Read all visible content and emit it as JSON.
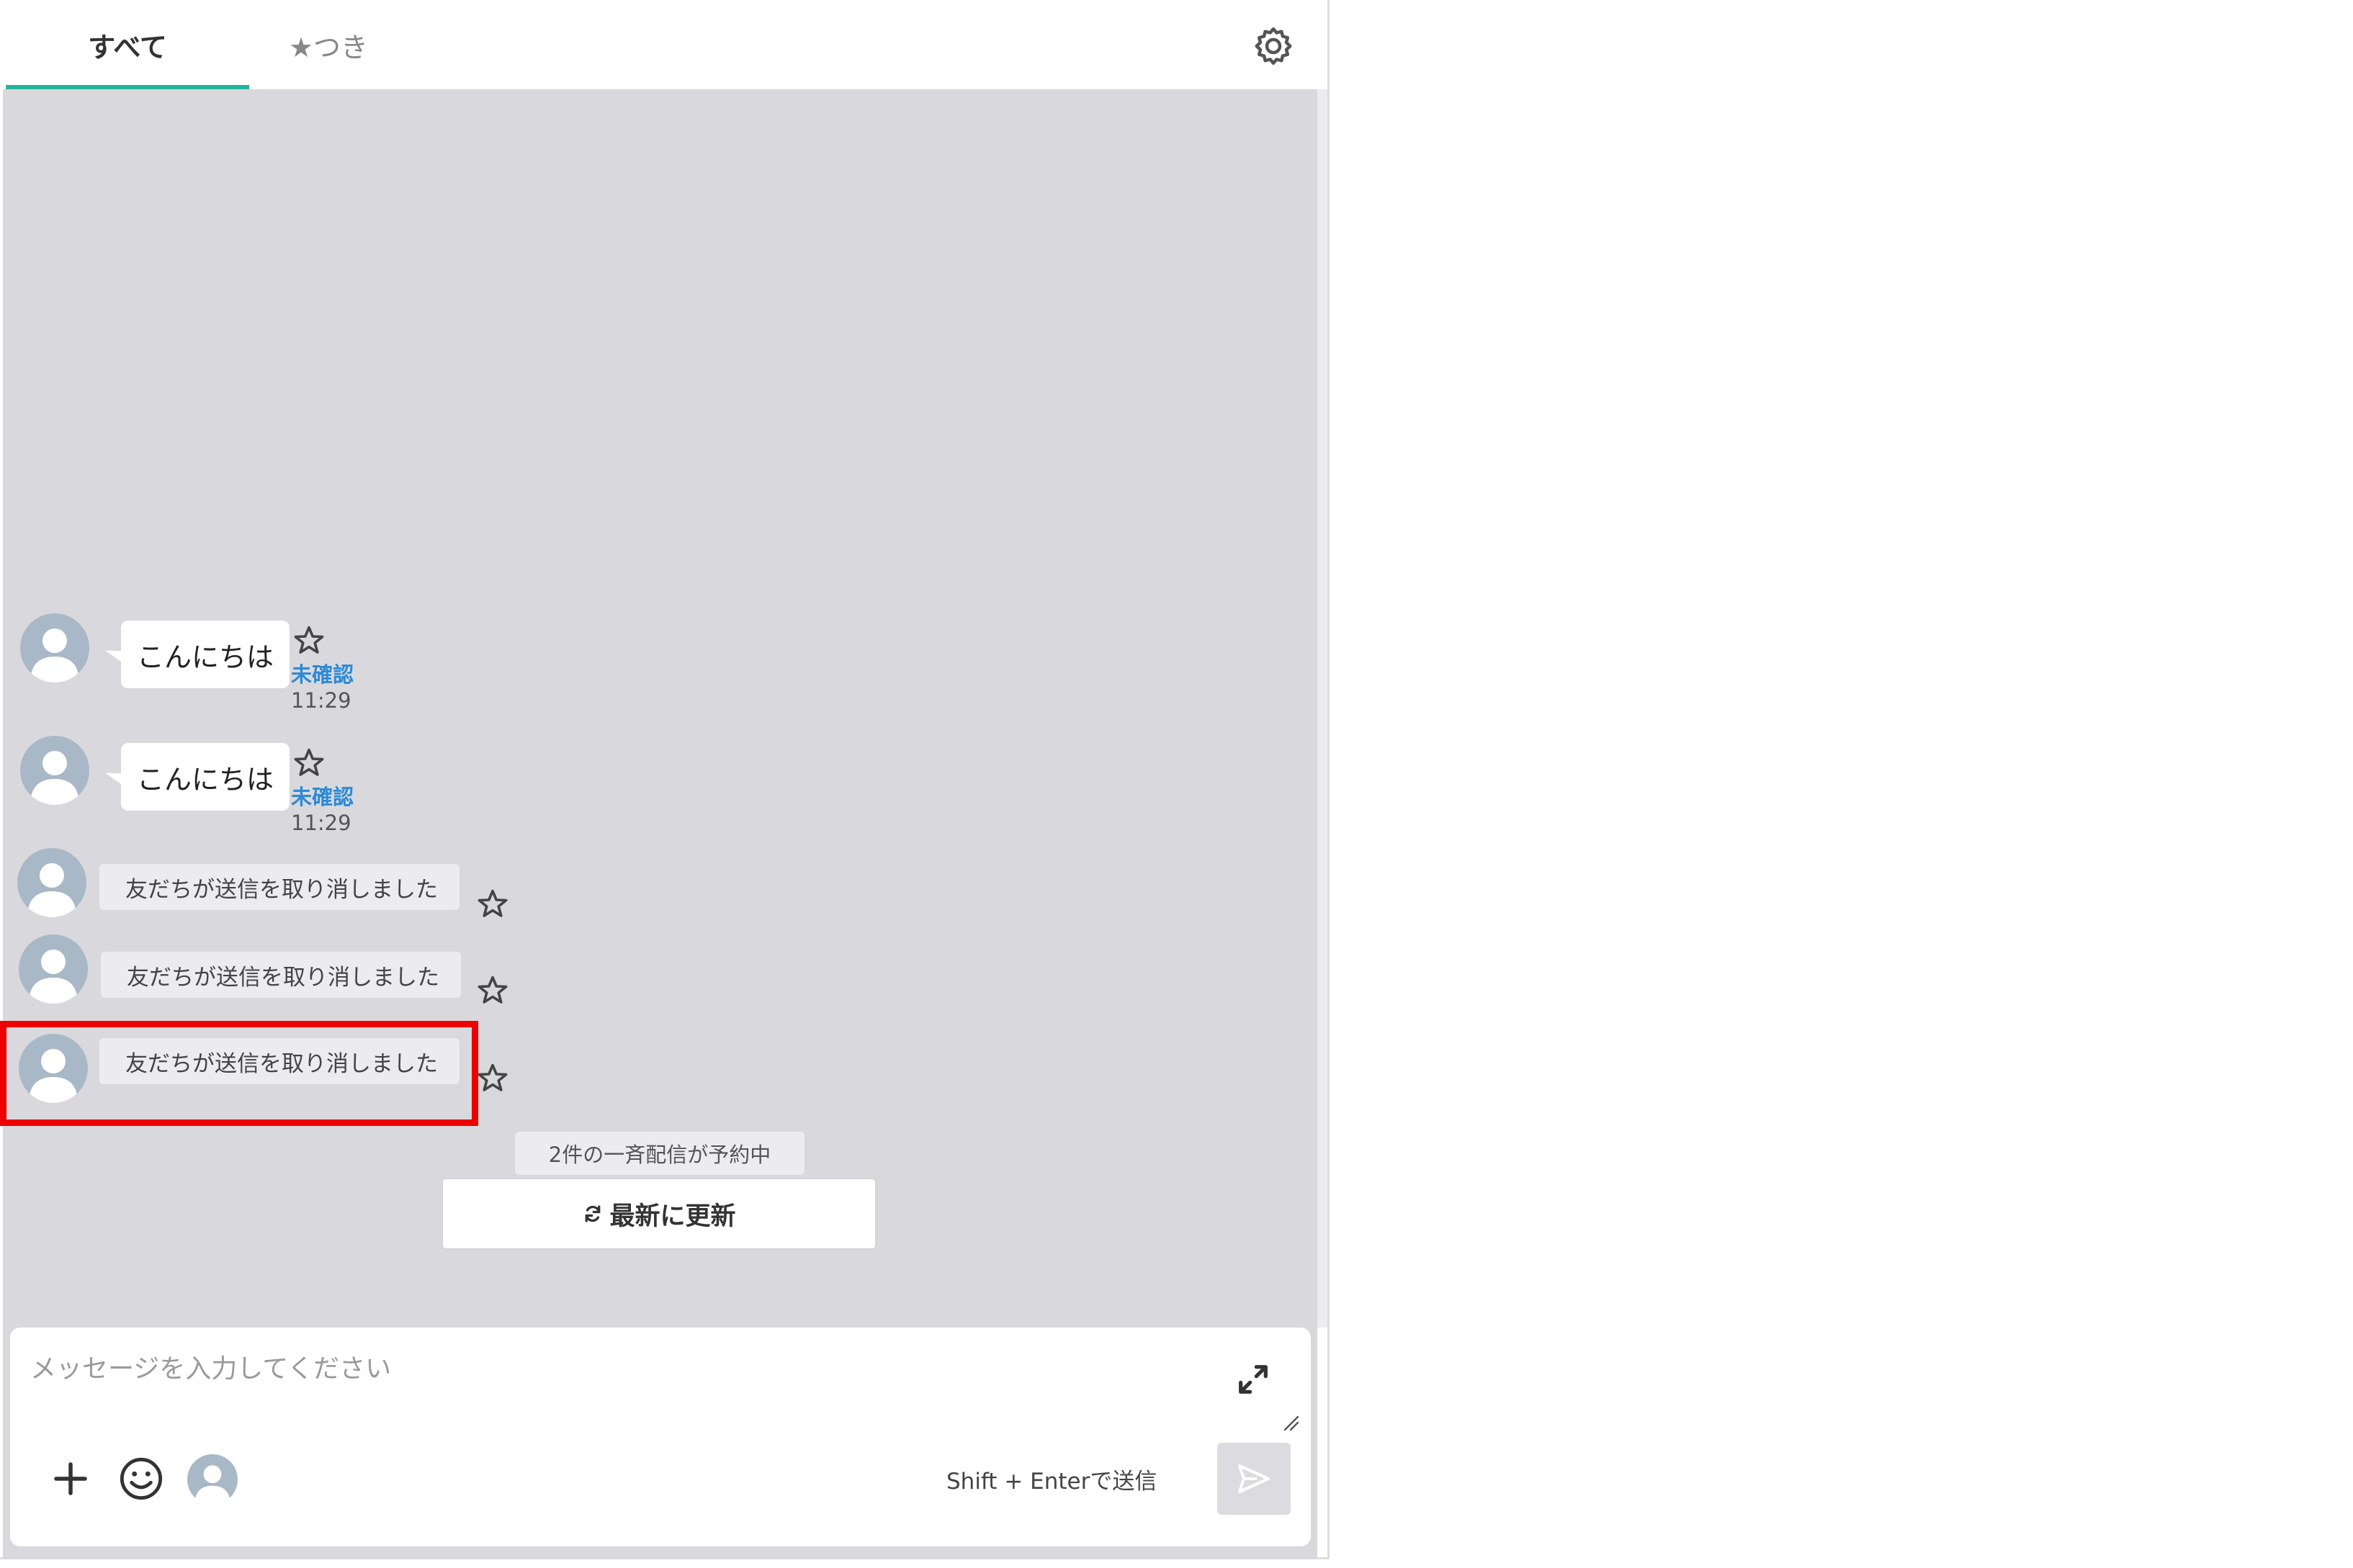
{
  "tabs": [
    {
      "label": "すべて",
      "active": true
    },
    {
      "label": "★つき",
      "active": false
    }
  ],
  "messages": [
    {
      "text": "こんにちは",
      "status": "未確認",
      "time": "11:29",
      "icon": "star-outline-icon"
    },
    {
      "text": "こんにちは",
      "status": "未確認",
      "time": "11:29",
      "icon": "star-outline-icon"
    }
  ],
  "retracted": [
    {
      "text": "友だちが送信を取り消しました"
    },
    {
      "text": "友だちが送信を取り消しました"
    },
    {
      "text": "友だちが送信を取り消しました"
    }
  ],
  "broadcast_notice": "2件の一斉配信が予約中",
  "refresh_label": "最新に更新",
  "composer": {
    "placeholder": "メッセージを入力してください",
    "hint": "Shift + Enterで送信"
  },
  "colors": {
    "accent": "#22b59a",
    "unread": "#2d8ad6",
    "chat_bg": "#d9d9dd",
    "highlight": "#ee0000"
  }
}
